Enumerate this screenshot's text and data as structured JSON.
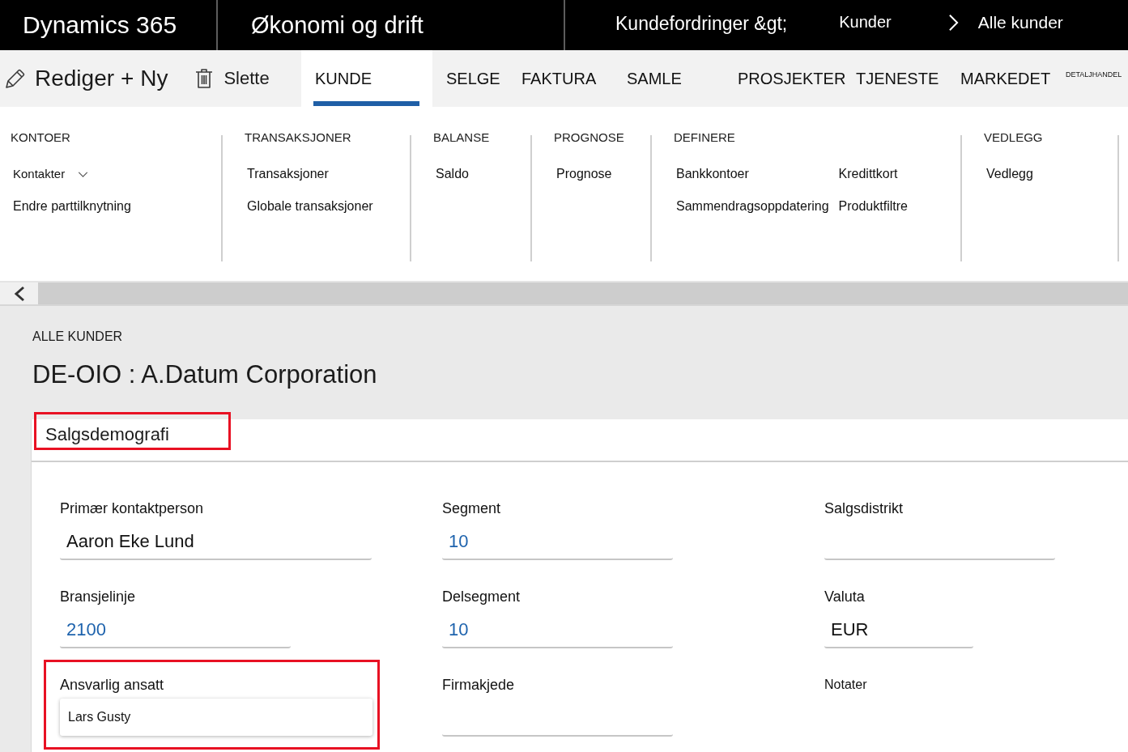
{
  "top_bar": {
    "app_name": "Dynamics 365",
    "module": "Økonomi og drift",
    "breadcrumb": [
      {
        "label": "Kundefordringer &gt;",
        "kind": "text"
      },
      {
        "label": "Kunder",
        "kind": "link"
      },
      {
        "label": "Alle kunder",
        "kind": "current"
      }
    ]
  },
  "action_bar": {
    "buttons": [
      {
        "label": "Rediger"
      },
      {
        "label": "+ Ny"
      },
      {
        "label": "Slette"
      }
    ],
    "tabs": [
      {
        "label": "KUNDE",
        "selected": true,
        "kind": "tab"
      },
      {
        "label": "SELGE",
        "selected": false,
        "kind": "tab"
      },
      {
        "label": "FAKTURA",
        "selected": false,
        "kind": "tab"
      },
      {
        "label": "SAMLE",
        "selected": false,
        "kind": "tab"
      },
      {
        "label": "PROSJEKTER",
        "selected": false,
        "kind": "tab"
      },
      {
        "label": "TJENESTE",
        "selected": false,
        "kind": "tab"
      },
      {
        "label": "MARKEDET",
        "selected": false,
        "kind": "tab"
      },
      {
        "label": "DETALJHANDEL",
        "selected": false,
        "kind": "compact"
      }
    ]
  },
  "ribbon": {
    "groups": [
      {
        "title": "KONTOER",
        "columns": [
          [
            {
              "label": "Kontakter",
              "dropdown": true
            },
            {
              "label": "Endre parttilknytning",
              "dropdown": false
            }
          ]
        ]
      },
      {
        "title": "TRANSAKSJONER",
        "columns": [
          [
            {
              "label": "Transaksjoner",
              "dropdown": false
            },
            {
              "label": "Globale transaksjoner",
              "dropdown": false
            }
          ]
        ]
      },
      {
        "title": "BALANSE",
        "columns": [
          [
            {
              "label": "Saldo",
              "dropdown": false
            }
          ]
        ]
      },
      {
        "title": "PROGNOSE",
        "columns": [
          [
            {
              "label": "Prognose",
              "dropdown": false
            }
          ]
        ]
      },
      {
        "title": "DEFINERE",
        "columns": [
          [
            {
              "label": "Bankkontoer",
              "dropdown": false
            },
            {
              "label": "Sammendragsoppdatering",
              "dropdown": false
            }
          ],
          [
            {
              "label": "Kredittkort",
              "dropdown": false
            },
            {
              "label": "Produktfiltre",
              "dropdown": false
            }
          ]
        ]
      },
      {
        "title": "VEDLEGG",
        "columns": [
          [
            {
              "label": "Vedlegg",
              "dropdown": false
            }
          ]
        ]
      }
    ]
  },
  "page": {
    "caption": "ALLE KUNDER",
    "title": "DE-OIO : A.Datum Corporation"
  },
  "section": {
    "title": "Salgsdemografi",
    "highlighted": true,
    "fields": [
      {
        "label": "Primær kontaktperson",
        "value": "Aaron Eke Lund",
        "kind": "text",
        "highlighted": false
      },
      {
        "label": "Segment",
        "value": "10",
        "kind": "lookup",
        "highlighted": false
      },
      {
        "label": "Salgsdistrikt",
        "kind": "text",
        "highlighted": false
      },
      {
        "label": "Bransjelinje",
        "value": "2100",
        "kind": "lookup",
        "highlighted": false
      },
      {
        "label": "Delsegment",
        "value": "10",
        "kind": "lookup",
        "highlighted": false
      },
      {
        "label": "Valuta",
        "value": "EUR",
        "kind": "text",
        "highlighted": false
      },
      {
        "label": "Ansvarlig ansatt",
        "value": "Lars Gusty",
        "kind": "boxed",
        "highlighted": true
      },
      {
        "label": "Firmakjede",
        "kind": "text",
        "highlighted": false
      },
      {
        "label": "Notater",
        "kind": "notes",
        "highlighted": false
      }
    ]
  }
}
